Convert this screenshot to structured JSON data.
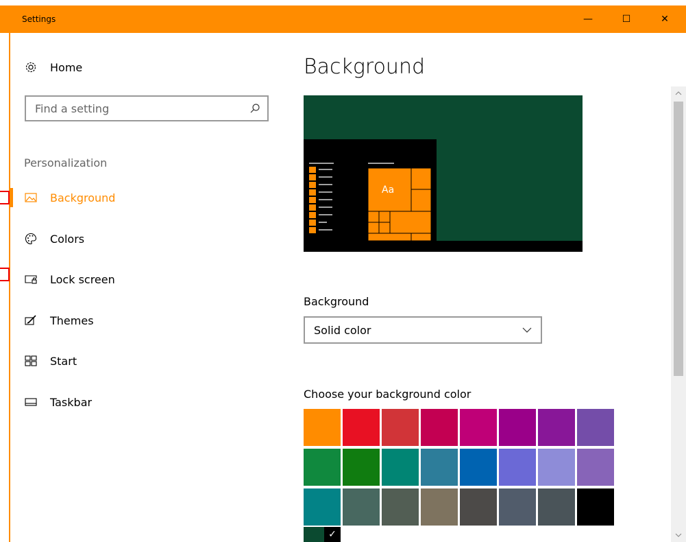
{
  "window": {
    "title": "Settings",
    "minimize_glyph": "—",
    "maximize_glyph": "☐",
    "close_glyph": "✕"
  },
  "sidebar": {
    "home_label": "Home",
    "home_icon": "gear-icon",
    "search_placeholder": "Find a setting",
    "section_label": "Personalization",
    "items": [
      {
        "label": "Background",
        "icon": "picture-icon",
        "active": true
      },
      {
        "label": "Colors",
        "icon": "palette-icon",
        "active": false
      },
      {
        "label": "Lock screen",
        "icon": "lock-screen-icon",
        "active": false
      },
      {
        "label": "Themes",
        "icon": "brush-icon",
        "active": false
      },
      {
        "label": "Start",
        "icon": "start-tiles-icon",
        "active": false
      },
      {
        "label": "Taskbar",
        "icon": "taskbar-icon",
        "active": false
      }
    ]
  },
  "main": {
    "title": "Background",
    "preview": {
      "tile_text": "Aa"
    },
    "background_label": "Background",
    "background_value": "Solid color",
    "choose_color_label": "Choose your background color",
    "colors": [
      "#ff8c00",
      "#e81123",
      "#d13438",
      "#c30052",
      "#bf0077",
      "#9a0089",
      "#881798",
      "#744da9",
      "#10893e",
      "#107c10",
      "#018574",
      "#2d7d9a",
      "#0063b1",
      "#6b69d6",
      "#8e8cd8",
      "#8764b8",
      "#038387",
      "#486860",
      "#525e54",
      "#7e735f",
      "#4c4a48",
      "#515c6b",
      "#4a5459",
      "#000000"
    ],
    "custom_color": "#0b4a30",
    "custom_check": "✓"
  },
  "accent": "#ff8c00"
}
